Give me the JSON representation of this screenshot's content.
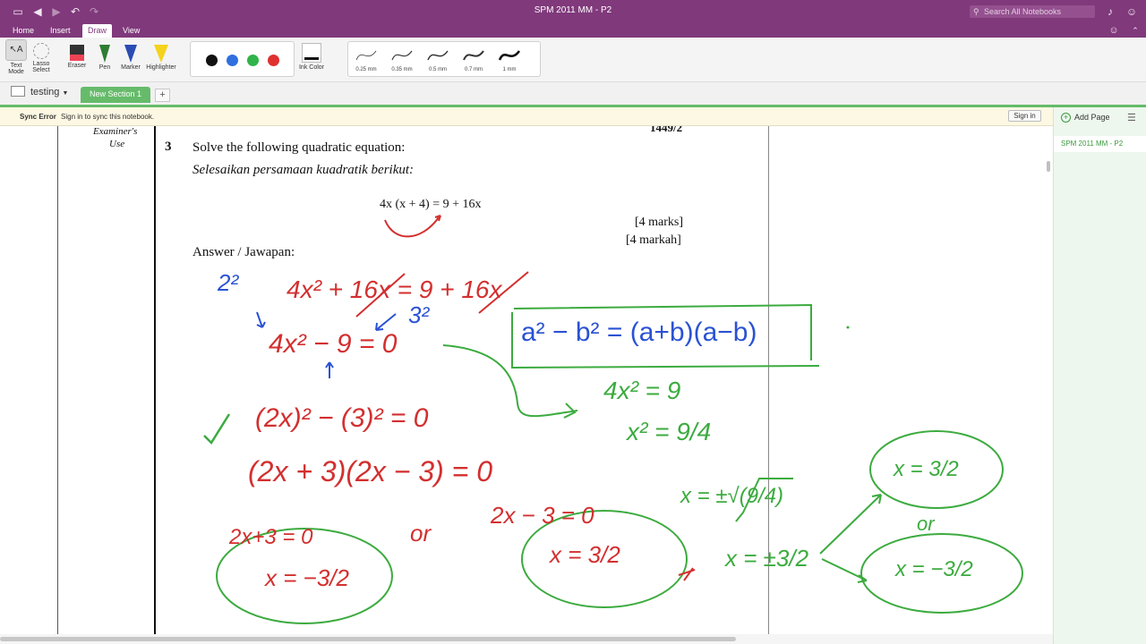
{
  "window": {
    "title": "SPM 2011 MM - P2",
    "search_placeholder": "Search All Notebooks"
  },
  "menu_tabs": [
    {
      "label": "Home"
    },
    {
      "label": "Insert"
    },
    {
      "label": "Draw"
    },
    {
      "label": "View"
    }
  ],
  "ribbon": {
    "text_mode": "Text Mode",
    "lasso_select": "Lasso Select",
    "eraser": "Eraser",
    "pen": "Pen",
    "marker": "Marker",
    "highlighter": "Highlighter",
    "ink_color": "Ink Color",
    "colors": [
      "#111111",
      "#2f6fe0",
      "#2fb34a",
      "#e03131"
    ],
    "pen_widths": [
      "0.25 mm",
      "0.35 mm",
      "0.5 mm",
      "0.7 mm",
      "1 mm"
    ]
  },
  "notebook": {
    "name": "testing",
    "section": "New Section 1"
  },
  "sync": {
    "error_label": "Sync Error",
    "message": "Sign in to sync this notebook.",
    "signin_button": "Sign in"
  },
  "sidebar": {
    "add_page": "Add Page",
    "pages": [
      "SPM 2011 MM - P2"
    ]
  },
  "document": {
    "code": "1449/2",
    "examiner": "Examiner's",
    "examiner2": "Use",
    "qnum": "3",
    "question_en": "Solve the following quadratic equation:",
    "question_ms": "Selesaikan persamaan kuadratik berikut:",
    "equation": "4x (x + 4)  =  9  +  16x",
    "marks_en": "[4 marks]",
    "marks_ms": "[4 markah]",
    "answer": "Answer / Jawapan:"
  },
  "ink": {
    "blue_squares": "2²",
    "blue_three_sq": "3²",
    "eq1": "4x² + 16x = 9 + 16x",
    "eq2": "4x² − 9 = 0",
    "eq3": "(2x)² − (3)² = 0",
    "eq4": "(2x + 3)(2x − 3) = 0",
    "eq5a": "2x+3 = 0",
    "or": "or",
    "eq5b": "2x − 3 = 0",
    "sol_neg": "x = −3/2",
    "sol_pos": "x = 3/2",
    "identity": "a² − b² = (a+b)(a−b)",
    "g1": "4x² = 9",
    "g2": "x² = 9/4",
    "g3": "x = ±√(9/4)",
    "g4": "x = ±3/2",
    "g_or": "or",
    "g_pos": "x = 3/2",
    "g_neg": "x = −3/2"
  }
}
